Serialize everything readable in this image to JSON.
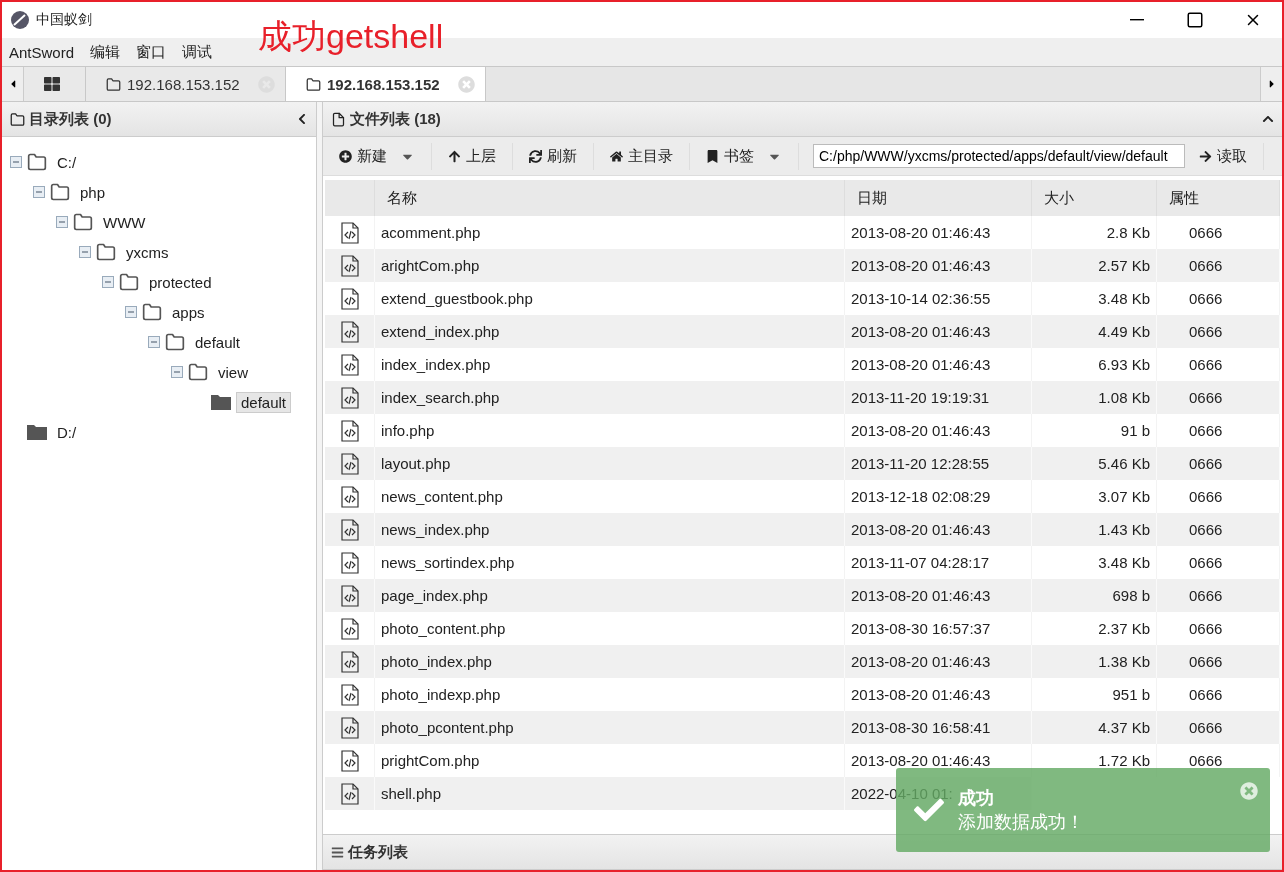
{
  "window": {
    "title": "中国蚁剑"
  },
  "annotation": "成功getshell",
  "menu": [
    "AntSword",
    "编辑",
    "窗口",
    "调试"
  ],
  "tabs": [
    {
      "kind": "home",
      "selected": false
    },
    {
      "kind": "shell",
      "label": "192.168.153.152",
      "selected": false
    },
    {
      "kind": "shell",
      "label": "192.168.153.152",
      "selected": true
    }
  ],
  "dir_panel": {
    "title": "目录列表 (0)",
    "tree": [
      {
        "label": "C:/",
        "expanded": true,
        "selected": false,
        "children": [
          {
            "label": "php",
            "expanded": true,
            "selected": false,
            "children": [
              {
                "label": "WWW",
                "expanded": true,
                "selected": false,
                "children": [
                  {
                    "label": "yxcms",
                    "expanded": true,
                    "selected": false,
                    "children": [
                      {
                        "label": "protected",
                        "expanded": true,
                        "selected": false,
                        "children": [
                          {
                            "label": "apps",
                            "expanded": true,
                            "selected": false,
                            "children": [
                              {
                                "label": "default",
                                "expanded": true,
                                "selected": false,
                                "children": [
                                  {
                                    "label": "view",
                                    "expanded": true,
                                    "selected": false,
                                    "children": [
                                      {
                                        "label": "default",
                                        "expanded": false,
                                        "selected": true
                                      }
                                    ]
                                  }
                                ]
                              }
                            ]
                          }
                        ]
                      }
                    ]
                  }
                ]
              }
            ]
          }
        ]
      },
      {
        "label": "D:/",
        "expanded": false,
        "selected": false
      }
    ]
  },
  "file_panel": {
    "title": "文件列表 (18)",
    "toolbar": [
      {
        "kind": "new",
        "label": "新建",
        "dropdown": true
      },
      {
        "kind": "up",
        "label": "上层",
        "dropdown": false
      },
      {
        "kind": "refresh",
        "label": "刷新",
        "dropdown": false
      },
      {
        "kind": "home",
        "label": "主目录",
        "dropdown": false
      },
      {
        "kind": "bookmark",
        "label": "书签",
        "dropdown": true
      }
    ],
    "path": "C:/php/WWW/yxcms/protected/apps/default/view/default",
    "read_button": "读取",
    "columns": [
      "名称",
      "日期",
      "大小",
      "属性"
    ],
    "rows": [
      [
        "acomment.php",
        "2013-08-20 01:46:43",
        "2.8 Kb",
        "0666"
      ],
      [
        "arightCom.php",
        "2013-08-20 01:46:43",
        "2.57 Kb",
        "0666"
      ],
      [
        "extend_guestbook.php",
        "2013-10-14 02:36:55",
        "3.48 Kb",
        "0666"
      ],
      [
        "extend_index.php",
        "2013-08-20 01:46:43",
        "4.49 Kb",
        "0666"
      ],
      [
        "index_index.php",
        "2013-08-20 01:46:43",
        "6.93 Kb",
        "0666"
      ],
      [
        "index_search.php",
        "2013-11-20 19:19:31",
        "1.08 Kb",
        "0666"
      ],
      [
        "info.php",
        "2013-08-20 01:46:43",
        "91 b",
        "0666"
      ],
      [
        "layout.php",
        "2013-11-20 12:28:55",
        "5.46 Kb",
        "0666"
      ],
      [
        "news_content.php",
        "2013-12-18 02:08:29",
        "3.07 Kb",
        "0666"
      ],
      [
        "news_index.php",
        "2013-08-20 01:46:43",
        "1.43 Kb",
        "0666"
      ],
      [
        "news_sortindex.php",
        "2013-11-07 04:28:17",
        "3.48 Kb",
        "0666"
      ],
      [
        "page_index.php",
        "2013-08-20 01:46:43",
        "698 b",
        "0666"
      ],
      [
        "photo_content.php",
        "2013-08-30 16:57:37",
        "2.37 Kb",
        "0666"
      ],
      [
        "photo_index.php",
        "2013-08-20 01:46:43",
        "1.38 Kb",
        "0666"
      ],
      [
        "photo_indexp.php",
        "2013-08-20 01:46:43",
        "951 b",
        "0666"
      ],
      [
        "photo_pcontent.php",
        "2013-08-30 16:58:41",
        "4.37 Kb",
        "0666"
      ],
      [
        "prightCom.php",
        "2013-08-20 01:46:43",
        "1.72 Kb",
        "0666"
      ],
      [
        "shell.php",
        "2022-04-10 01:"
      ]
    ]
  },
  "task_panel": {
    "title": "任务列表"
  },
  "toast": {
    "title": "成功",
    "message": "添加数据成功！"
  }
}
